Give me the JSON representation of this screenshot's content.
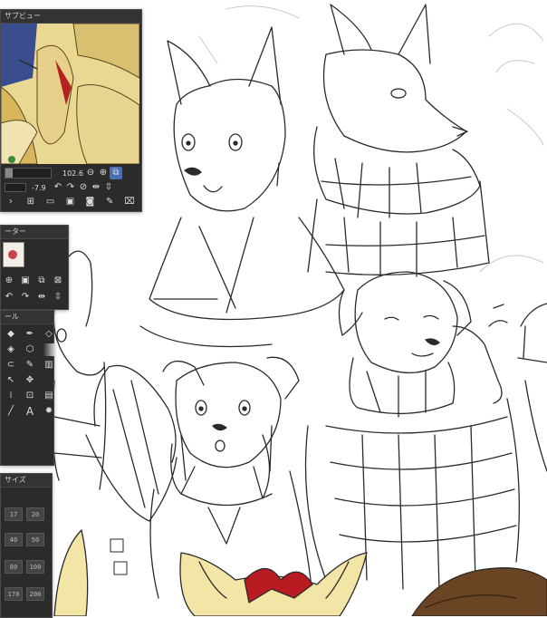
{
  "subview": {
    "title": "サブビュー",
    "zoom": "102.6",
    "rotation": "-7.9",
    "zoom_out_icon": "minus-circle-icon",
    "zoom_in_icon": "plus-circle-icon",
    "fit_icon": "fit-view-icon"
  },
  "layer_panel": {
    "title": "ーター"
  },
  "tools_panel": {
    "title": "ール"
  },
  "size_panel": {
    "title": "サイズ",
    "sizes": [
      "17",
      "20",
      "40",
      "50",
      "80",
      "100",
      "170",
      "200"
    ]
  },
  "accent": {
    "panel_bg": "#2b2b2b",
    "canvas_bg": "#ffffff",
    "line": "#2a2a2a",
    "highlight": "#4a8fd8"
  }
}
